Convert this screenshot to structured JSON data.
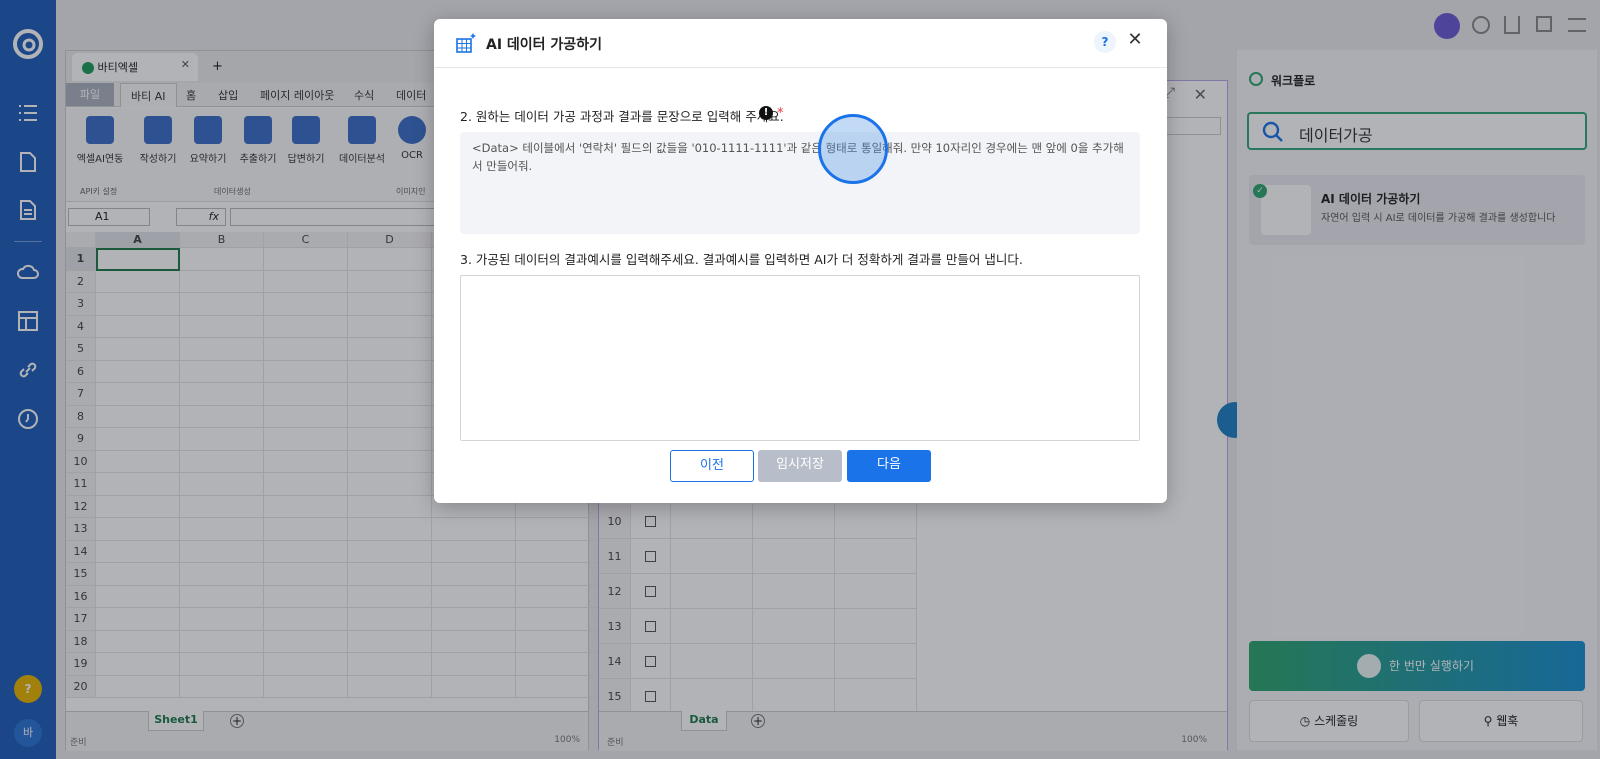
{
  "rail": {
    "help_badge": "?",
    "user_avatar": "바"
  },
  "excel": {
    "file_tab": "바티엑셀",
    "new_tab": "+",
    "ribbon_tabs": [
      "파일",
      "바티 AI",
      "홈",
      "삽입",
      "페이지 레이아웃",
      "수식",
      "데이터"
    ],
    "buttons": [
      "엑셀AI연동",
      "작성하기",
      "요약하기",
      "추출하기",
      "답변하기",
      "데이터분석",
      "OCR"
    ],
    "group_labels": [
      "API키 설정",
      "데이터생성",
      "이미지인"
    ],
    "cell_ref": "A1",
    "fx": "fx",
    "columns": [
      "A",
      "B",
      "C",
      "D"
    ],
    "rows": [
      "1",
      "2",
      "3",
      "4",
      "5",
      "6",
      "7",
      "8",
      "9",
      "10",
      "11",
      "12",
      "13",
      "14",
      "15",
      "16",
      "17",
      "18",
      "19",
      "20"
    ],
    "sheet_tab": "Sheet1",
    "status": "준비",
    "zoom": "100%"
  },
  "center": {
    "rows": [
      "10",
      "11",
      "12",
      "13",
      "14",
      "15"
    ],
    "sheet_tab": "Data",
    "status": "준비",
    "zoom": "100%"
  },
  "workflow": {
    "title": "워크플로",
    "search_value": "데이터가공",
    "card_title": "AI 데이터 가공하기",
    "card_desc": "자연어 입력 시 AI로 데이터를 가공해 결과를 생성합니다",
    "run_once": "한 번만 실행하기",
    "scheduling": "스케줄링",
    "webhook": "웹훅"
  },
  "dialog": {
    "title": "AI 데이터 가공하기",
    "help": "?",
    "q2_label": "2. 원하는 데이터 가공 과정과 결과를 문장으로 입력해 주세요.",
    "required_mark": "*",
    "q2_value": "<Data> 테이블에서 '연락처' 필드의 값들을 '010-1111-1111'과 같은 형태로 통일해줘. 만약 10자리인 경우에는 맨 앞에 0을 추가해서 만들어줘.",
    "q3_label": "3. 가공된 데이터의 결과예시를 입력해주세요. 결과예시를 입력하면 AI가 더 정확하게 결과를 만들어 냅니다.",
    "q3_value": "",
    "prev": "이전",
    "temp_save": "임시저장",
    "next": "다음"
  },
  "colors": {
    "rail": "#1e5db9",
    "accent": "#1a73e8",
    "run_gradient_start": "#2ea66d",
    "run_gradient_end": "#1a8fd0"
  }
}
